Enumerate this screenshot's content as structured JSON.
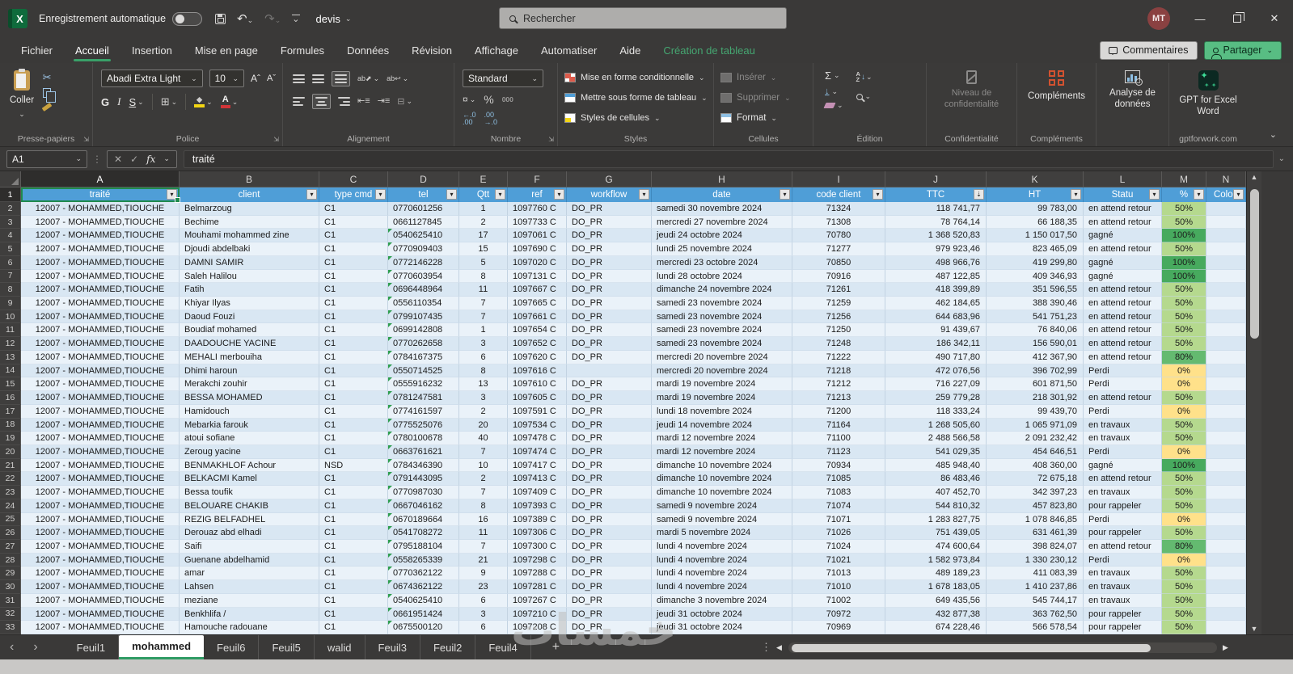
{
  "titlebar": {
    "autosave_label": "Enregistrement automatique",
    "doc_name": "devis",
    "search_placeholder": "Rechercher",
    "avatar_initials": "MT"
  },
  "tabs": [
    {
      "label": "Fichier"
    },
    {
      "label": "Accueil",
      "active": true
    },
    {
      "label": "Insertion"
    },
    {
      "label": "Mise en page"
    },
    {
      "label": "Formules"
    },
    {
      "label": "Données"
    },
    {
      "label": "Révision"
    },
    {
      "label": "Affichage"
    },
    {
      "label": "Automatiser"
    },
    {
      "label": "Aide"
    },
    {
      "label": "Création de tableau",
      "contextual": true
    }
  ],
  "tabbar_right": {
    "comments": "Commentaires",
    "share": "Partager"
  },
  "ribbon": {
    "paste_label": "Coller",
    "clipboard_group": "Presse-papiers",
    "font_name": "Abadi Extra Light",
    "font_size": "10",
    "bold": "G",
    "italic": "I",
    "underline": "S",
    "font_group": "Police",
    "alignment_group": "Alignement",
    "number_format": "Standard",
    "thousands": "000",
    "number_group": "Nombre",
    "styles_buttons": [
      "Mise en forme conditionnelle",
      "Mettre sous forme de tableau",
      "Styles de cellules"
    ],
    "styles_group": "Styles",
    "cells_insert": "Insérer",
    "cells_delete": "Supprimer",
    "cells_format": "Format",
    "cells_group": "Cellules",
    "editing_group": "Édition",
    "privacy_label": "Niveau de confidentialité",
    "privacy_group": "Confidentialité",
    "addins_label": "Compléments",
    "addins_group": "Compléments",
    "analyze_label": "Analyse de données",
    "gpt_label": "GPT for Excel Word",
    "gpt_group": "gptforwork.com"
  },
  "formula_bar": {
    "name_box": "A1",
    "fx": "fx",
    "value": "traité"
  },
  "grid": {
    "col_letters": [
      "A",
      "B",
      "C",
      "D",
      "E",
      "F",
      "G",
      "H",
      "I",
      "J",
      "K",
      "L",
      "M",
      "N"
    ],
    "table_headers": [
      "traité",
      "client",
      "type cmd",
      "tel",
      "Qtt",
      "ref",
      "workflow",
      "date",
      "code client",
      "TTC",
      "HT",
      "Statu",
      "%",
      "Colon"
    ],
    "traite_value": "12007 - MOHAMMED,TIOUCHE",
    "rows": [
      [
        "Belmarzoug",
        "C1",
        "0770601256",
        "1",
        "1097760 C",
        "DO_PR",
        "samedi 30 novembre 2024",
        "71324",
        "118 741,77",
        "99 783,00",
        "en attend retour",
        "50%",
        "g50",
        false
      ],
      [
        "Bechime",
        "C1",
        "0661127845",
        "2",
        "1097733 C",
        "DO_PR",
        "mercredi 27 novembre 2024",
        "71308",
        "78 764,14",
        "66 188,35",
        "en attend retour",
        "50%",
        "g50",
        false
      ],
      [
        "Mouhami mohammed zine",
        "C1",
        "0540625410",
        "17",
        "1097061 C",
        "DO_PR",
        "jeudi 24 octobre 2024",
        "70780",
        "1 368 520,83",
        "1 150 017,50",
        "gagné",
        "100%",
        "g100",
        true
      ],
      [
        "Djoudi abdelbaki",
        "C1",
        "0770909403",
        "15",
        "1097690 C",
        "DO_PR",
        "lundi 25 novembre 2024",
        "71277",
        "979 923,46",
        "823 465,09",
        "en attend retour",
        "50%",
        "g50",
        true
      ],
      [
        "DAMNI SAMIR",
        "C1",
        "0772146228",
        "5",
        "1097020 C",
        "DO_PR",
        "mercredi 23 octobre 2024",
        "70850",
        "498 966,76",
        "419 299,80",
        "gagné",
        "100%",
        "g100",
        true
      ],
      [
        "Saleh Halilou",
        "C1",
        "0770603954",
        "8",
        "1097131 C",
        "DO_PR",
        "lundi 28 octobre 2024",
        "70916",
        "487 122,85",
        "409 346,93",
        "gagné",
        "100%",
        "g100",
        true
      ],
      [
        "Fatih",
        "C1",
        "0696448964",
        "11",
        "1097667 C",
        "DO_PR",
        "dimanche 24 novembre 2024",
        "71261",
        "418 399,89",
        "351 596,55",
        "en attend retour",
        "50%",
        "g50",
        true
      ],
      [
        "Khiyar Ilyas",
        "C1",
        "0556110354",
        "7",
        "1097665 C",
        "DO_PR",
        "samedi 23 novembre 2024",
        "71259",
        "462 184,65",
        "388 390,46",
        "en attend retour",
        "50%",
        "g50",
        true
      ],
      [
        "Daoud Fouzi",
        "C1",
        "0799107435",
        "7",
        "1097661 C",
        "DO_PR",
        "samedi 23 novembre 2024",
        "71256",
        "644 683,96",
        "541 751,23",
        "en attend retour",
        "50%",
        "g50",
        true
      ],
      [
        "Boudiaf mohamed",
        "C1",
        "0699142808",
        "1",
        "1097654 C",
        "DO_PR",
        "samedi 23 novembre 2024",
        "71250",
        "91 439,67",
        "76 840,06",
        "en attend retour",
        "50%",
        "g50",
        true
      ],
      [
        "DAADOUCHE YACINE",
        "C1",
        "0770262658",
        "3",
        "1097652 C",
        "DO_PR",
        "samedi 23 novembre 2024",
        "71248",
        "186 342,11",
        "156 590,01",
        "en attend retour",
        "50%",
        "g50",
        true
      ],
      [
        "MEHALI merbouiha",
        "C1",
        "0784167375",
        "6",
        "1097620 C",
        "DO_PR",
        "mercredi 20 novembre 2024",
        "71222",
        "490 717,80",
        "412 367,90",
        "en attend retour",
        "80%",
        "g80",
        true
      ],
      [
        "Dhimi haroun",
        "C1",
        "0550714525",
        "8",
        "1097616 C",
        "",
        "mercredi 20 novembre 2024",
        "71218",
        "472 076,56",
        "396 702,99",
        "Perdi",
        "0%",
        "y0",
        true
      ],
      [
        "Merakchi zouhir",
        "C1",
        "0555916232",
        "13",
        "1097610 C",
        "DO_PR",
        "mardi 19 novembre 2024",
        "71212",
        "716 227,09",
        "601 871,50",
        "Perdi",
        "0%",
        "y0",
        true
      ],
      [
        "BESSA MOHAMED",
        "C1",
        "0781247581",
        "3",
        "1097605 C",
        "DO_PR",
        "mardi 19 novembre 2024",
        "71213",
        "259 779,28",
        "218 301,92",
        "en attend retour",
        "50%",
        "g50",
        true
      ],
      [
        "Hamidouch",
        "C1",
        "0774161597",
        "2",
        "1097591 C",
        "DO_PR",
        "lundi 18 novembre 2024",
        "71200",
        "118 333,24",
        "99 439,70",
        "Perdi",
        "0%",
        "y0",
        true
      ],
      [
        "Mebarkia farouk",
        "C1",
        "0775525076",
        "20",
        "1097534 C",
        "DO_PR",
        "jeudi 14 novembre 2024",
        "71164",
        "1 268 505,60",
        "1 065 971,09",
        "en travaux",
        "50%",
        "g50",
        true
      ],
      [
        "atoui sofiane",
        "C1",
        "0780100678",
        "40",
        "1097478 C",
        "DO_PR",
        "mardi 12 novembre 2024",
        "71100",
        "2 488 566,58",
        "2 091 232,42",
        "en travaux",
        "50%",
        "g50",
        true
      ],
      [
        "Zeroug yacine",
        "C1",
        "0663761621",
        "7",
        "1097474 C",
        "DO_PR",
        "mardi 12 novembre 2024",
        "71123",
        "541 029,35",
        "454 646,51",
        "Perdi",
        "0%",
        "y0",
        true
      ],
      [
        "BENMAKHLOF Achour",
        "NSD",
        "0784346390",
        "10",
        "1097417 C",
        "DO_PR",
        "dimanche 10 novembre 2024",
        "70934",
        "485 948,40",
        "408 360,00",
        "gagné",
        "100%",
        "g100",
        true
      ],
      [
        "BELKACMI Kamel",
        "C1",
        "0791443095",
        "2",
        "1097413 C",
        "DO_PR",
        "dimanche 10 novembre 2024",
        "71085",
        "86 483,46",
        "72 675,18",
        "en attend retour",
        "50%",
        "g50",
        true
      ],
      [
        "Bessa toufik",
        "C1",
        "0770987030",
        "7",
        "1097409 C",
        "DO_PR",
        "dimanche 10 novembre 2024",
        "71083",
        "407 452,70",
        "342 397,23",
        "en travaux",
        "50%",
        "g50",
        true
      ],
      [
        "BELOUARE CHAKIB",
        "C1",
        "0667046162",
        "8",
        "1097393 C",
        "DO_PR",
        "samedi 9 novembre 2024",
        "71074",
        "544 810,32",
        "457 823,80",
        "pour rappeler",
        "50%",
        "g50",
        true
      ],
      [
        "REZIG BELFADHEL",
        "C1",
        "0670189664",
        "16",
        "1097389 C",
        "DO_PR",
        "samedi 9 novembre 2024",
        "71071",
        "1 283 827,75",
        "1 078 846,85",
        "Perdi",
        "0%",
        "y0",
        true
      ],
      [
        "Derouaz abd elhadi",
        "C1",
        "0541708272",
        "11",
        "1097306 C",
        "DO_PR",
        "mardi 5 novembre 2024",
        "71026",
        "751 439,05",
        "631 461,39",
        "pour rappeler",
        "50%",
        "g50",
        true
      ],
      [
        "Saifi",
        "C1",
        "0795188104",
        "7",
        "1097300 C",
        "DO_PR",
        "lundi 4 novembre 2024",
        "71024",
        "474 600,64",
        "398 824,07",
        "en attend retour",
        "80%",
        "g80",
        true
      ],
      [
        "Guenane abdelhamid",
        "C1",
        "0558265339",
        "21",
        "1097298 C",
        "DO_PR",
        "lundi 4 novembre 2024",
        "71021",
        "1 582 973,84",
        "1 330 230,12",
        "Perdi",
        "0%",
        "y0",
        true
      ],
      [
        "amar",
        "C1",
        "0770362122",
        "9",
        "1097288 C",
        "DO_PR",
        "lundi 4 novembre 2024",
        "71013",
        "489 189,23",
        "411 083,39",
        "en travaux",
        "50%",
        "g50",
        true
      ],
      [
        "Lahsen",
        "C1",
        "0674362122",
        "23",
        "1097281 C",
        "DO_PR",
        "lundi 4 novembre 2024",
        "71010",
        "1 678 183,05",
        "1 410 237,86",
        "en travaux",
        "50%",
        "g50",
        true
      ],
      [
        "meziane",
        "C1",
        "0540625410",
        "6",
        "1097267 C",
        "DO_PR",
        "dimanche 3 novembre 2024",
        "71002",
        "649 435,56",
        "545 744,17",
        "en travaux",
        "50%",
        "g50",
        true
      ],
      [
        "Benkhlifa /",
        "C1",
        "0661951424",
        "3",
        "1097210 C",
        "DO_PR",
        "jeudi 31 octobre 2024",
        "70972",
        "432 877,38",
        "363 762,50",
        "pour rappeler",
        "50%",
        "g50",
        true
      ],
      [
        "Hamouche radouane",
        "C1",
        "0675500120",
        "6",
        "1097208 C",
        "DO_PR",
        "jeudi 31 octobre 2024",
        "70969",
        "674 228,46",
        "566 578,54",
        "pour rappeler",
        "50%",
        "g50",
        true
      ]
    ]
  },
  "sheetbar": {
    "tabs": [
      {
        "label": "Feuil1"
      },
      {
        "label": "mohammed",
        "active": true
      },
      {
        "label": "Feuil6"
      },
      {
        "label": "Feuil5"
      },
      {
        "label": "walid"
      },
      {
        "label": "Feuil3"
      },
      {
        "label": "Feuil2"
      },
      {
        "label": "Feuil4"
      }
    ]
  },
  "watermark": "خمسات",
  "colors": {
    "table_header_blue": "#4f9ed7",
    "selection_green": "#1f8a4d",
    "active_tab_underline": "#2e9b63",
    "share_button_green": "#58bd83",
    "pct_50": "#b5d98e",
    "pct_80": "#64ba70",
    "pct_100": "#47aa5e",
    "pct_0": "#ffe18a",
    "band_dark": "#d9e7f3",
    "band_light": "#eaf2f9"
  }
}
